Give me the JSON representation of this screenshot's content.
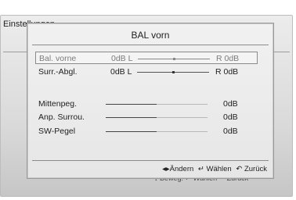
{
  "background": {
    "title": "Einstellungen",
    "hints": [
      "↕ Beweg.",
      "↵ Wählen",
      "↶ Zurück"
    ]
  },
  "dialog": {
    "title": "BAL vorn",
    "rows": [
      {
        "label": "Bal. vorne",
        "left": "0dB L",
        "right": "R 0dB",
        "balance": 0.5
      },
      {
        "label": "Surr.-Abgl.",
        "left": "0dB L",
        "right": "R 0dB",
        "balance": 0.5
      },
      {
        "label": "Mittenpeg.",
        "value": "0dB",
        "level": 0.5
      },
      {
        "label": "Anp. Surrou.",
        "value": "0dB",
        "level": 0.5
      },
      {
        "label": "SW-Pegel",
        "value": "0dB",
        "level": 0.5
      }
    ],
    "hints": {
      "change": "◂▸Ändern",
      "select": "↵ Wählen",
      "back": "↶ Zurück"
    }
  }
}
